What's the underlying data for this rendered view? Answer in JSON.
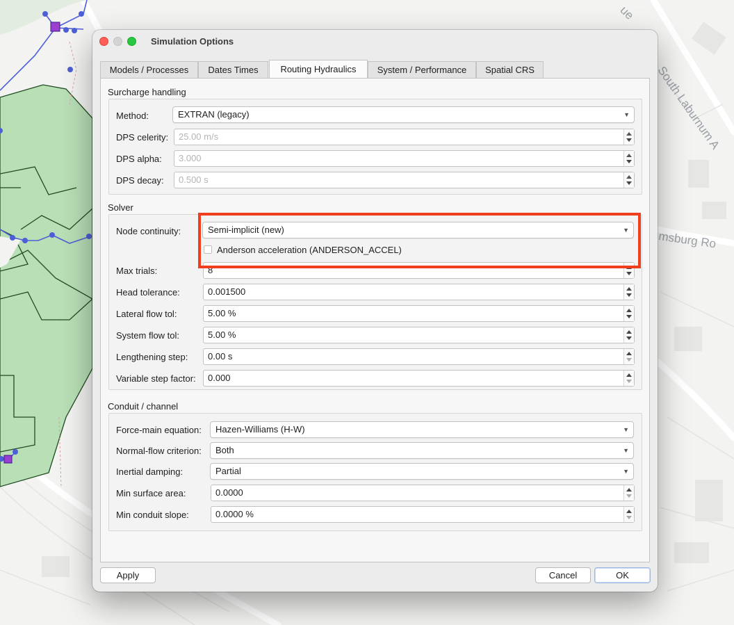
{
  "window": {
    "title": "Simulation Options"
  },
  "map": {
    "streets": [
      "South Laburnum A",
      "msburg Ro",
      "ue"
    ]
  },
  "tabs": [
    {
      "label": "Models / Processes"
    },
    {
      "label": "Dates  Times"
    },
    {
      "label": "Routing  Hydraulics",
      "active": true
    },
    {
      "label": "System / Performance"
    },
    {
      "label": "Spatial  CRS"
    }
  ],
  "surcharge": {
    "title": "Surcharge handling",
    "method_label": "Method:",
    "method_value": "EXTRAN (legacy)",
    "celerity_label": "DPS celerity:",
    "celerity_value": "25.00 m/s",
    "alpha_label": "DPS alpha:",
    "alpha_value": "3.000",
    "decay_label": "DPS decay:",
    "decay_value": "0.500 s"
  },
  "solver": {
    "title": "Solver",
    "node_continuity_label": "Node continuity:",
    "node_continuity_value": "Semi-implicit (new)",
    "anderson_label": "Anderson acceleration (ANDERSON_ACCEL)",
    "anderson_checked": false,
    "max_trials_label": "Max trials:",
    "max_trials_value": "8",
    "head_tol_label": "Head tolerance:",
    "head_tol_value": "0.001500",
    "lateral_tol_label": "Lateral flow tol:",
    "lateral_tol_value": "5.00 %",
    "system_tol_label": "System flow tol:",
    "system_tol_value": "5.00 %",
    "lengthening_label": "Lengthening step:",
    "lengthening_value": "0.00 s",
    "variable_label": "Variable step factor:",
    "variable_value": "0.000"
  },
  "conduit": {
    "title": "Conduit / channel",
    "force_main_label": "Force-main equation:",
    "force_main_value": "Hazen-Williams (H-W)",
    "normal_flow_label": "Normal-flow criterion:",
    "normal_flow_value": "Both",
    "inertial_label": "Inertial damping:",
    "inertial_value": "Partial",
    "min_area_label": "Min surface area:",
    "min_area_value": "0.0000",
    "min_slope_label": "Min conduit slope:",
    "min_slope_value": "0.0000 %"
  },
  "buttons": {
    "apply": "Apply",
    "cancel": "Cancel",
    "ok": "OK"
  },
  "colors": {
    "highlight": "#ef3f1c",
    "subcatchment_fill": "#b9dfb7",
    "network": "#4d5fd6",
    "node": "#9b3fd0"
  }
}
